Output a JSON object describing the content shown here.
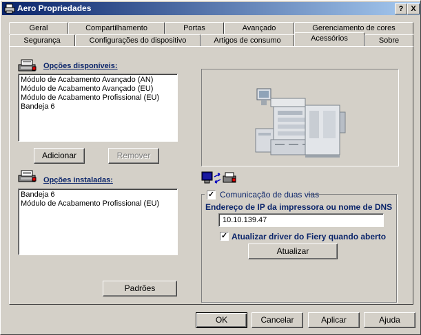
{
  "window": {
    "title": "Aero Propriedades",
    "help_button": "?",
    "close_button": "X"
  },
  "tabs_back_row": [
    "Geral",
    "Compartilhamento",
    "Portas",
    "Avançado",
    "Gerenciamento de cores"
  ],
  "tabs_front_row": [
    "Segurança",
    "Configurações do dispositivo",
    "Artigos de consumo",
    "Acessórios",
    "Sobre"
  ],
  "selected_tab": "Acessórios",
  "available_options": {
    "label": "Opções disponíveis:",
    "items": [
      "Módulo de Acabamento Avançado (AN)",
      "Módulo de Acabamento Avançado (EU)",
      "Módulo de Acabamento Profissional (EU)",
      "Bandeja 6"
    ],
    "add_button": "Adicionar",
    "remove_button": "Remover"
  },
  "installed_options": {
    "label": "Opções instaladas:",
    "items": [
      "Bandeja 6",
      "Módulo de Acabamento Profissional (EU)"
    ],
    "defaults_button": "Padrões"
  },
  "two_way": {
    "label": "Comunicação de duas vias",
    "checked": true,
    "address_label": "Endereço de IP da impressora ou nome de DNS",
    "address_value": "10.10.139.47",
    "update_driver_label": "Atualizar driver do Fiery quando aberto",
    "update_driver_checked": true,
    "update_button": "Atualizar"
  },
  "footer": {
    "ok": "OK",
    "cancel": "Cancelar",
    "apply": "Aplicar",
    "help": "Ajuda"
  },
  "colors": {
    "title_start": "#0a246a",
    "title_end": "#a6caf0",
    "label_blue": "#0a246a",
    "face": "#d4d0c8"
  }
}
